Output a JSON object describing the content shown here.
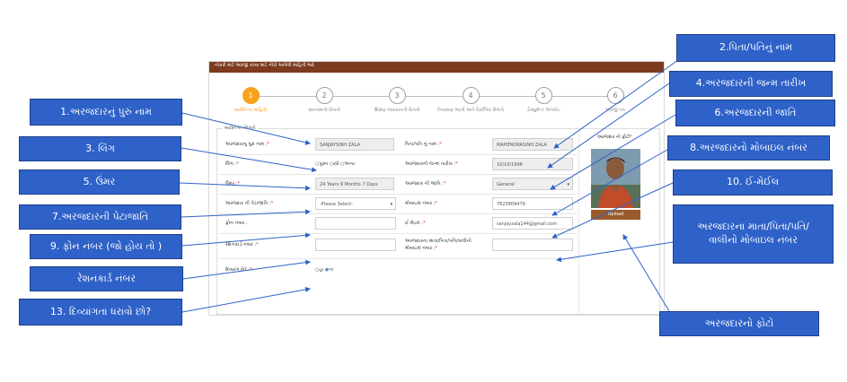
{
  "form": {
    "banner": "નોકરી માટે અરજી કરવા માટે નીચે આપેલી માહિતી ભરો",
    "steps": [
      {
        "num": "1",
        "label": "વ્યક્તિગત માહિતી",
        "active": true
      },
      {
        "num": "2",
        "label": "સરનામાંની વિગતો",
        "active": false
      },
      {
        "num": "3",
        "label": "શિક્ષણ લાયકાતની વિગતો",
        "active": false
      },
      {
        "num": "4",
        "label": "નિવાસણ ભરતી અને વૈકલ્પિક વિગતો",
        "active": false
      },
      {
        "num": "5",
        "label": "ડોક્યુમેન્ટ અપલોડ",
        "active": false
      },
      {
        "num": "6",
        "label": "અરજી પત્ર",
        "active": false
      }
    ],
    "panel_title": "વ્યક્તિગત વિગતો",
    "full_name_label": "અરજદારનું પુરું નામ :",
    "full_name_value": "SANJAYSINH ZALA",
    "father_name_label": "પિતા/પતિ નું નામ :",
    "father_name_value": "MAHENDRASINH ZALA",
    "gender_label": "લિંગ :",
    "gender_options": [
      "પુરુષ",
      "સ્ત્રી",
      "અન્ય"
    ],
    "dob_label": "અરજદારની જન્મ તારીખ :",
    "dob_value": "10/10/1996",
    "age_label": "ઉંમર :",
    "age_value": "24 Years 9 Months 7 Days",
    "caste_label": "અરજદાર ની જાતિ :",
    "caste_value": "General",
    "subcaste_label": "અરજદાર ની પેટાજાતિ :",
    "subcaste_value": "-Please Select-",
    "mobile_label": "મોબાઇલ નંબર :",
    "mobile_value": "7623809479",
    "phone_label": "ફોન નંબર :",
    "phone_value": "",
    "email_label": "ઈ-મેઇલ :",
    "email_value": "sanjayzala144@gmail.com",
    "ration_label": "રેશનકાર્ડ નંબર :",
    "ration_value": "",
    "parent_mobile_label": "અરજદારના માતા/પિતા/પતિ/વાલીનો મોબાઇલ નંબર :",
    "parent_mobile_value": "",
    "disability_label": "દિવ્યાંગ છે? :",
    "disability_options": [
      "હા",
      "ના"
    ],
    "photo_label": "અરજદાર નો ફોટો",
    "upload_label": "Upload"
  },
  "callouts": {
    "c1": "1.અરજદારનું પુરું નામ",
    "c2": "2.પિતા/પતિનું નામ",
    "c3": "3. લિંગ",
    "c4": "4.અરજદારની જન્મ તારીખ",
    "c5": "5. ઉંમર",
    "c6": "6.અરજદારની જાતિ",
    "c7": "7.અરજદારની પેટાજાતિ",
    "c8": "8.અરજદારનો મોબાઇલ નંબર",
    "c9": "9. ફોન નંબર (જો હોય તો )",
    "c10": "10. ઈ-મેઈલ",
    "c_ration": "રેશનકાર્ડ નંબર",
    "c_parent_mobile": "અરજદારના માતા/પિતા/પતિ/વાલીનો મોબાઇલ નંબર",
    "c13": "13. દિવ્યાંગતા ધરાવો છો?",
    "c_photo": "અરજદારનો ફોટો"
  },
  "colors": {
    "callout": "#2f62c8",
    "arrow": "#2f62c8",
    "active_step": "#f6a21d",
    "upload": "#9a5a2a"
  }
}
